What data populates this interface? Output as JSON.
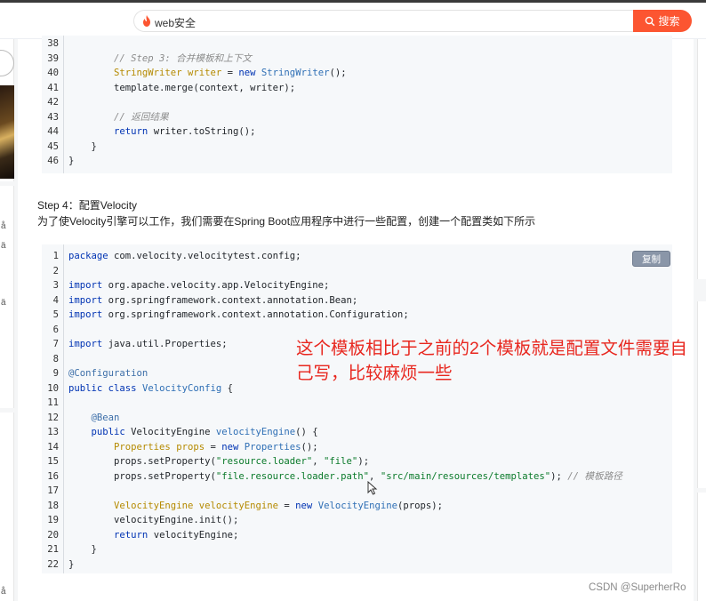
{
  "search": {
    "query": "web安全",
    "button_label": "搜索"
  },
  "left_sidebar": {
    "chars": [
      "å",
      "ä",
      "ä",
      "å"
    ]
  },
  "code_block_1": {
    "lines": [
      {
        "n": "38",
        "code": ""
      },
      {
        "n": "39",
        "code": "        // Step 3: 合并模板和上下文"
      },
      {
        "n": "40",
        "code": "        StringWriter writer = new StringWriter();"
      },
      {
        "n": "41",
        "code": "        template.merge(context, writer);"
      },
      {
        "n": "42",
        "code": ""
      },
      {
        "n": "43",
        "code": "        // 返回结果"
      },
      {
        "n": "44",
        "code": "        return writer.toString();"
      },
      {
        "n": "45",
        "code": "    }"
      },
      {
        "n": "46",
        "code": "}"
      }
    ]
  },
  "step4": {
    "title": "Step 4：配置Velocity",
    "description": "为了使Velocity引擎可以工作，我们需要在Spring Boot应用程序中进行一些配置，创建一个配置类如下所示"
  },
  "code_block_2": {
    "copy_label": "复制",
    "lines": [
      {
        "n": "1",
        "code": "package com.velocity.velocitytest.config;"
      },
      {
        "n": "2",
        "code": ""
      },
      {
        "n": "3",
        "code": "import org.apache.velocity.app.VelocityEngine;"
      },
      {
        "n": "4",
        "code": "import org.springframework.context.annotation.Bean;"
      },
      {
        "n": "5",
        "code": "import org.springframework.context.annotation.Configuration;"
      },
      {
        "n": "6",
        "code": ""
      },
      {
        "n": "7",
        "code": "import java.util.Properties;"
      },
      {
        "n": "8",
        "code": ""
      },
      {
        "n": "9",
        "code": "@Configuration"
      },
      {
        "n": "10",
        "code": "public class VelocityConfig {"
      },
      {
        "n": "11",
        "code": ""
      },
      {
        "n": "12",
        "code": "    @Bean"
      },
      {
        "n": "13",
        "code": "    public VelocityEngine velocityEngine() {"
      },
      {
        "n": "14",
        "code": "        Properties props = new Properties();"
      },
      {
        "n": "15",
        "code": "        props.setProperty(\"resource.loader\", \"file\");"
      },
      {
        "n": "16",
        "code": "        props.setProperty(\"file.resource.loader.path\", \"src/main/resources/templates\"); // 模板路径"
      },
      {
        "n": "17",
        "code": ""
      },
      {
        "n": "18",
        "code": "        VelocityEngine velocityEngine = new VelocityEngine(props);"
      },
      {
        "n": "19",
        "code": "        velocityEngine.init();"
      },
      {
        "n": "20",
        "code": "        return velocityEngine;"
      },
      {
        "n": "21",
        "code": "    }"
      },
      {
        "n": "22",
        "code": "}"
      }
    ]
  },
  "annotation": {
    "text": "这个模板相比于之前的2个模板就是配置文件需要自己写，比较麻烦一些"
  },
  "watermark": "CSDN @SuperherRo",
  "colors": {
    "search_button": "#fc5531",
    "annotation": "#e8271f",
    "code_bg": "#f6f8fa",
    "copy_button": "#8a96a8"
  }
}
